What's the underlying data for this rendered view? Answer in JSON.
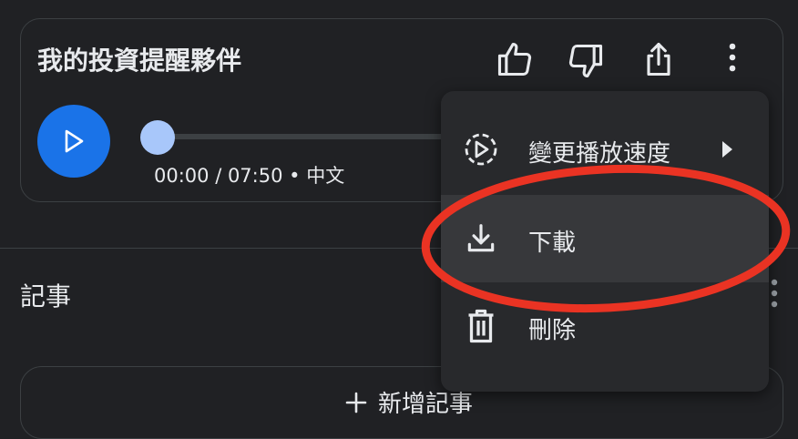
{
  "player": {
    "title": "我的投資提醒夥伴",
    "time": "00:00 / 07:50 • 中文",
    "progress_fraction": 0.0
  },
  "notes": {
    "title": "記事",
    "add_label": "新增記事"
  },
  "menu": {
    "items": [
      {
        "label": "變更播放速度",
        "icon": "playback-speed-icon",
        "has_submenu": true
      },
      {
        "label": "下載",
        "icon": "download-icon",
        "highlighted": true
      },
      {
        "label": "刪除",
        "icon": "trash-icon"
      }
    ]
  },
  "colors": {
    "background": "#202124",
    "accent": "#1a73e8",
    "progress_knob": "#a8c7fa",
    "menu_background": "#28292c",
    "annotation": "#ea3323"
  }
}
